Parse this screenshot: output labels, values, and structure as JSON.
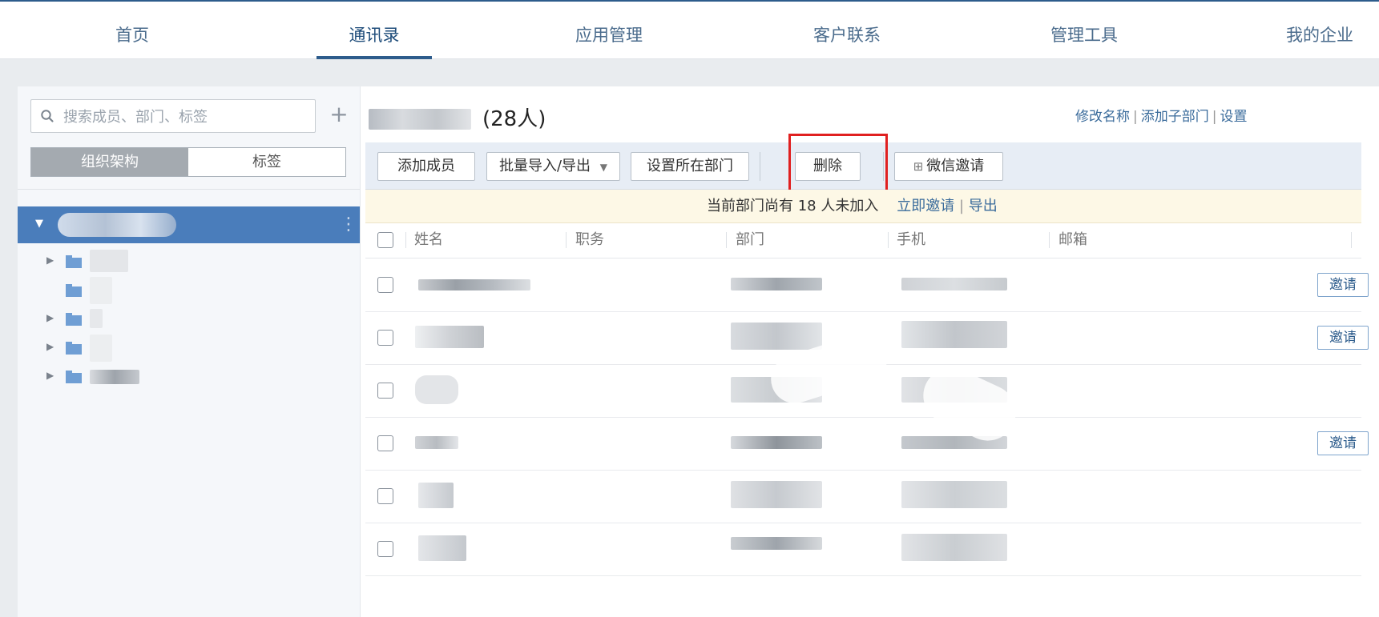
{
  "nav": {
    "items": [
      {
        "label": "首页"
      },
      {
        "label": "通讯录"
      },
      {
        "label": "应用管理"
      },
      {
        "label": "客户联系"
      },
      {
        "label": "管理工具"
      },
      {
        "label": "我的企业"
      }
    ],
    "active_index": 1
  },
  "sidebar": {
    "search_placeholder": "搜索成员、部门、标签",
    "add_icon": "plus-icon",
    "tabs": [
      {
        "label": "组织架构",
        "active": true
      },
      {
        "label": "标签",
        "active": false
      }
    ]
  },
  "department": {
    "count_label": "(28人)",
    "links": [
      "修改名称",
      "添加子部门",
      "设置"
    ]
  },
  "toolbar": {
    "add_member": "添加成员",
    "batch_import_export": "批量导入/导出",
    "dropdown_arrow": "▼",
    "set_department": "设置所在部门",
    "delete": "删除",
    "wechat_invite": "微信邀请"
  },
  "notice": {
    "text": "当前部门尚有 18 人未加入",
    "invite_now": "立即邀请",
    "separator": "|",
    "export": "导出"
  },
  "table": {
    "headers": [
      "姓名",
      "职务",
      "部门",
      "手机",
      "邮箱"
    ],
    "invite_label": "邀请",
    "rows": [
      {
        "invite": true
      },
      {
        "invite": true
      },
      {
        "invite": false
      },
      {
        "invite": true
      },
      {
        "invite": false
      },
      {
        "invite": false
      }
    ]
  },
  "colors": {
    "nav_accent": "#2d5c8c",
    "tree_selected": "#4a7dbb",
    "highlight_box": "#e02020"
  }
}
